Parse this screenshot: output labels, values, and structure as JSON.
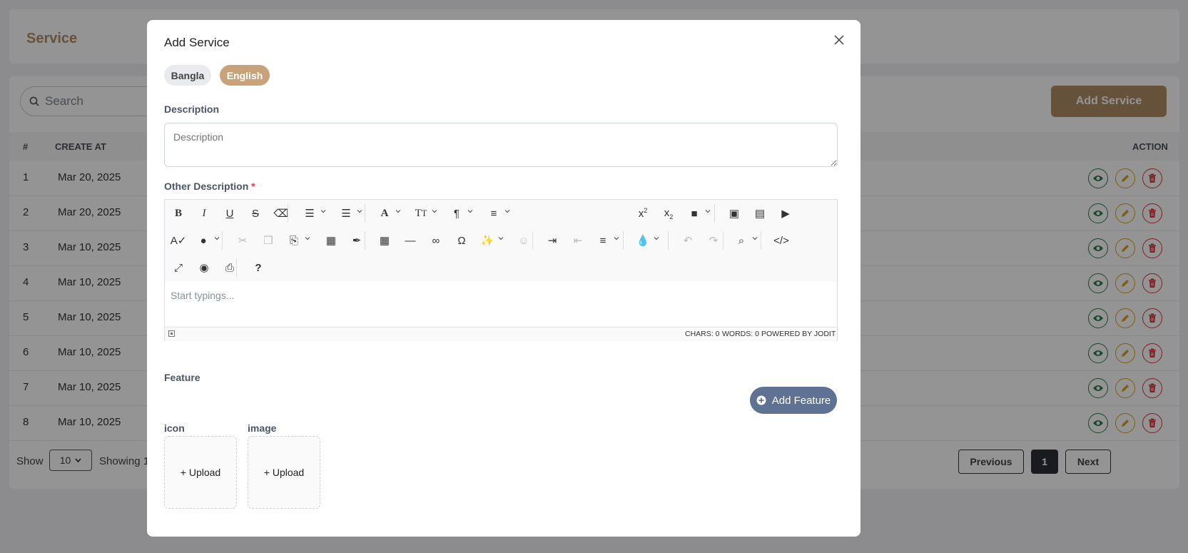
{
  "page": {
    "title": "Service",
    "search_placeholder": "Search",
    "add_service_label": "Add Service",
    "table": {
      "headers": {
        "index": "#",
        "created": "CREATE AT",
        "action": "ACTION"
      },
      "rows": [
        {
          "idx": "1",
          "date": "Mar 20, 2025"
        },
        {
          "idx": "2",
          "date": "Mar 20, 2025"
        },
        {
          "idx": "3",
          "date": "Mar 10, 2025"
        },
        {
          "idx": "4",
          "date": "Mar 10, 2025"
        },
        {
          "idx": "5",
          "date": "Mar 10, 2025"
        },
        {
          "idx": "6",
          "date": "Mar 10, 2025"
        },
        {
          "idx": "7",
          "date": "Mar 10, 2025"
        },
        {
          "idx": "8",
          "date": "Mar 10, 2025"
        }
      ]
    },
    "footer": {
      "show_label": "Show",
      "page_size": "10",
      "showing_text": "Showing 1",
      "previous": "Previous",
      "current_page": "1",
      "next": "Next"
    }
  },
  "modal": {
    "title": "Add Service",
    "tabs": [
      {
        "label": "Bangla"
      },
      {
        "label": "English",
        "active": true
      }
    ],
    "description_label": "Description",
    "description_placeholder": "Description",
    "other_description_label": "Other Description",
    "required_mark": "*",
    "editor": {
      "placeholder": "Start typings...",
      "chars": "CHARS: 0",
      "words": "WORDS: 0",
      "powered": "POWERED BY JODIT",
      "toolbar_icons": [
        "bold-icon",
        "italic-icon",
        "underline-icon",
        "strikethrough-icon",
        "eraser-icon",
        "bulleted-list-icon",
        "numbered-list-icon",
        "font-icon",
        "font-size-icon",
        "paragraph-icon",
        "line-height-icon",
        "superscript-icon",
        "subscript-icon",
        "classes-icon",
        "image-icon",
        "file-icon",
        "video-icon",
        "spellcheck-icon",
        "microphone-icon",
        "cut-icon",
        "copy-icon",
        "paste-icon",
        "select-all-icon",
        "copy-format-icon",
        "table-icon",
        "horizontal-rule-icon",
        "link-icon",
        "symbol-icon",
        "ai-commands-icon",
        "ai-assistant-icon",
        "indent-icon",
        "outdent-icon",
        "align-icon",
        "brush-icon",
        "undo-icon",
        "redo-icon",
        "find-icon",
        "source-icon",
        "fullsize-icon",
        "preview-icon",
        "print-icon",
        "help-icon"
      ]
    },
    "feature_label": "Feature",
    "add_feature_label": "Add Feature",
    "icon_label": "icon",
    "image_label": "image",
    "upload_label": "+ Upload"
  },
  "colors": {
    "accent": "#b08d66",
    "feature_btn": "#5f7293",
    "view": "#2e7d4f",
    "edit": "#d9a21b",
    "delete": "#d9363e"
  }
}
